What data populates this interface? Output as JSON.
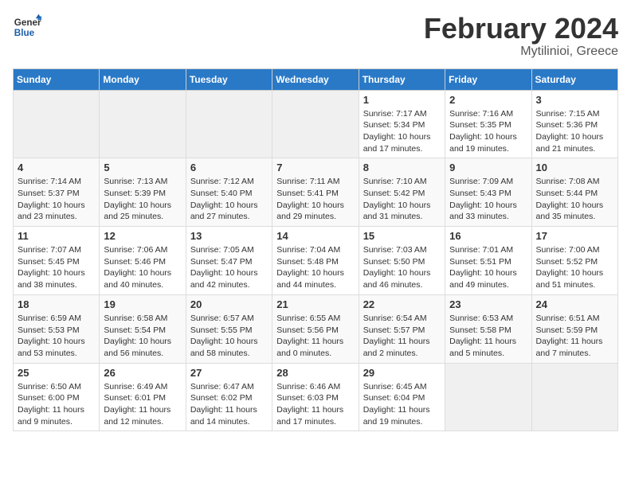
{
  "logo": {
    "text_general": "General",
    "text_blue": "Blue"
  },
  "title": "February 2024",
  "subtitle": "Mytilinioi, Greece",
  "days_of_week": [
    "Sunday",
    "Monday",
    "Tuesday",
    "Wednesday",
    "Thursday",
    "Friday",
    "Saturday"
  ],
  "weeks": [
    [
      {
        "day": "",
        "info": ""
      },
      {
        "day": "",
        "info": ""
      },
      {
        "day": "",
        "info": ""
      },
      {
        "day": "",
        "info": ""
      },
      {
        "day": "1",
        "info": "Sunrise: 7:17 AM\nSunset: 5:34 PM\nDaylight: 10 hours and 17 minutes."
      },
      {
        "day": "2",
        "info": "Sunrise: 7:16 AM\nSunset: 5:35 PM\nDaylight: 10 hours and 19 minutes."
      },
      {
        "day": "3",
        "info": "Sunrise: 7:15 AM\nSunset: 5:36 PM\nDaylight: 10 hours and 21 minutes."
      }
    ],
    [
      {
        "day": "4",
        "info": "Sunrise: 7:14 AM\nSunset: 5:37 PM\nDaylight: 10 hours and 23 minutes."
      },
      {
        "day": "5",
        "info": "Sunrise: 7:13 AM\nSunset: 5:39 PM\nDaylight: 10 hours and 25 minutes."
      },
      {
        "day": "6",
        "info": "Sunrise: 7:12 AM\nSunset: 5:40 PM\nDaylight: 10 hours and 27 minutes."
      },
      {
        "day": "7",
        "info": "Sunrise: 7:11 AM\nSunset: 5:41 PM\nDaylight: 10 hours and 29 minutes."
      },
      {
        "day": "8",
        "info": "Sunrise: 7:10 AM\nSunset: 5:42 PM\nDaylight: 10 hours and 31 minutes."
      },
      {
        "day": "9",
        "info": "Sunrise: 7:09 AM\nSunset: 5:43 PM\nDaylight: 10 hours and 33 minutes."
      },
      {
        "day": "10",
        "info": "Sunrise: 7:08 AM\nSunset: 5:44 PM\nDaylight: 10 hours and 35 minutes."
      }
    ],
    [
      {
        "day": "11",
        "info": "Sunrise: 7:07 AM\nSunset: 5:45 PM\nDaylight: 10 hours and 38 minutes."
      },
      {
        "day": "12",
        "info": "Sunrise: 7:06 AM\nSunset: 5:46 PM\nDaylight: 10 hours and 40 minutes."
      },
      {
        "day": "13",
        "info": "Sunrise: 7:05 AM\nSunset: 5:47 PM\nDaylight: 10 hours and 42 minutes."
      },
      {
        "day": "14",
        "info": "Sunrise: 7:04 AM\nSunset: 5:48 PM\nDaylight: 10 hours and 44 minutes."
      },
      {
        "day": "15",
        "info": "Sunrise: 7:03 AM\nSunset: 5:50 PM\nDaylight: 10 hours and 46 minutes."
      },
      {
        "day": "16",
        "info": "Sunrise: 7:01 AM\nSunset: 5:51 PM\nDaylight: 10 hours and 49 minutes."
      },
      {
        "day": "17",
        "info": "Sunrise: 7:00 AM\nSunset: 5:52 PM\nDaylight: 10 hours and 51 minutes."
      }
    ],
    [
      {
        "day": "18",
        "info": "Sunrise: 6:59 AM\nSunset: 5:53 PM\nDaylight: 10 hours and 53 minutes."
      },
      {
        "day": "19",
        "info": "Sunrise: 6:58 AM\nSunset: 5:54 PM\nDaylight: 10 hours and 56 minutes."
      },
      {
        "day": "20",
        "info": "Sunrise: 6:57 AM\nSunset: 5:55 PM\nDaylight: 10 hours and 58 minutes."
      },
      {
        "day": "21",
        "info": "Sunrise: 6:55 AM\nSunset: 5:56 PM\nDaylight: 11 hours and 0 minutes."
      },
      {
        "day": "22",
        "info": "Sunrise: 6:54 AM\nSunset: 5:57 PM\nDaylight: 11 hours and 2 minutes."
      },
      {
        "day": "23",
        "info": "Sunrise: 6:53 AM\nSunset: 5:58 PM\nDaylight: 11 hours and 5 minutes."
      },
      {
        "day": "24",
        "info": "Sunrise: 6:51 AM\nSunset: 5:59 PM\nDaylight: 11 hours and 7 minutes."
      }
    ],
    [
      {
        "day": "25",
        "info": "Sunrise: 6:50 AM\nSunset: 6:00 PM\nDaylight: 11 hours and 9 minutes."
      },
      {
        "day": "26",
        "info": "Sunrise: 6:49 AM\nSunset: 6:01 PM\nDaylight: 11 hours and 12 minutes."
      },
      {
        "day": "27",
        "info": "Sunrise: 6:47 AM\nSunset: 6:02 PM\nDaylight: 11 hours and 14 minutes."
      },
      {
        "day": "28",
        "info": "Sunrise: 6:46 AM\nSunset: 6:03 PM\nDaylight: 11 hours and 17 minutes."
      },
      {
        "day": "29",
        "info": "Sunrise: 6:45 AM\nSunset: 6:04 PM\nDaylight: 11 hours and 19 minutes."
      },
      {
        "day": "",
        "info": ""
      },
      {
        "day": "",
        "info": ""
      }
    ]
  ]
}
